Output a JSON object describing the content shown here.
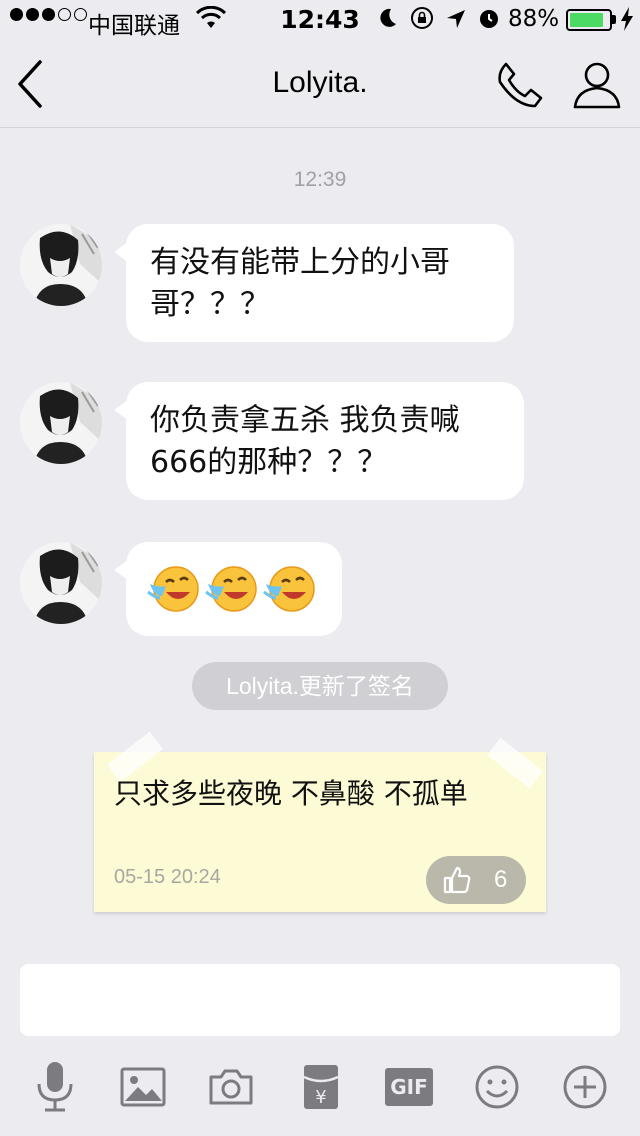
{
  "status_bar": {
    "carrier": "中国联通",
    "time": "12:43",
    "battery_percent": "88%",
    "battery_level": 0.88
  },
  "nav": {
    "title": "Lolyita."
  },
  "chat": {
    "timestamp": "12:39",
    "messages": [
      {
        "text": "有没有能带上分的小哥哥？？？"
      },
      {
        "text": "你负责拿五杀 我负责喊666的那种？？？"
      },
      {
        "emoji": "crying-laughing-emoji",
        "count": 3
      }
    ],
    "system_notice": "Lolyita.更新了签名",
    "signature": {
      "text": "只求多些夜晚 不鼻酸 不孤单",
      "date": "05-15 20:24",
      "likes": "6"
    }
  },
  "input": {
    "placeholder": ""
  },
  "toolbar": {
    "icons": [
      "microphone-icon",
      "image-icon",
      "camera-icon",
      "red-packet-icon",
      "gif-icon",
      "emoji-icon",
      "plus-icon"
    ],
    "gif_label": "GIF"
  },
  "colors": {
    "background": "#ebebf0",
    "bubble": "#ffffff",
    "signature_card": "#fcfbd6",
    "battery": "#4cd964"
  }
}
